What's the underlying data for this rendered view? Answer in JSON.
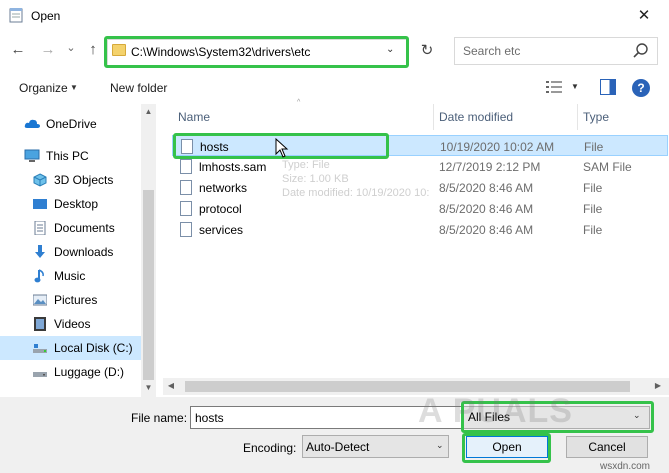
{
  "window": {
    "title": "Open",
    "close_glyph": "✕"
  },
  "nav": {
    "back_glyph": "←",
    "forward_glyph": "→",
    "recent_glyph": "⌄",
    "up_glyph": "↑",
    "address": "C:\\Windows\\System32\\drivers\\etc",
    "address_dropdown": "⌄",
    "refresh_glyph": "↻",
    "search_placeholder": "Search etc"
  },
  "toolbar": {
    "organize": "Organize",
    "organize_caret": "▼",
    "new_folder": "New folder",
    "view_caret": "▼",
    "help": "?"
  },
  "sidebar": {
    "items": [
      {
        "label": "OneDrive",
        "icon": "cloud-icon"
      },
      {
        "label": "This PC",
        "icon": "computer-icon"
      },
      {
        "label": "3D Objects",
        "icon": "cube-icon"
      },
      {
        "label": "Desktop",
        "icon": "desktop-icon"
      },
      {
        "label": "Documents",
        "icon": "documents-icon"
      },
      {
        "label": "Downloads",
        "icon": "download-icon"
      },
      {
        "label": "Music",
        "icon": "music-icon"
      },
      {
        "label": "Pictures",
        "icon": "pictures-icon"
      },
      {
        "label": "Videos",
        "icon": "videos-icon"
      },
      {
        "label": "Local Disk (C:)",
        "icon": "drive-icon"
      },
      {
        "label": "Luggage (D:)",
        "icon": "drive-icon"
      }
    ],
    "selected_index": 9
  },
  "columns": {
    "name": "Name",
    "date": "Date modified",
    "type": "Type",
    "sort_caret": "^"
  },
  "files": [
    {
      "name": "hosts",
      "date": "10/19/2020 10:02 AM",
      "type": "File"
    },
    {
      "name": "lmhosts.sam",
      "date": "12/7/2019 2:12 PM",
      "type": "SAM File"
    },
    {
      "name": "networks",
      "date": "8/5/2020 8:46 AM",
      "type": "File"
    },
    {
      "name": "protocol",
      "date": "8/5/2020 8:46 AM",
      "type": "File"
    },
    {
      "name": "services",
      "date": "8/5/2020 8:46 AM",
      "type": "File"
    }
  ],
  "tooltip": {
    "line1": "Type: File",
    "line2": "Size: 1.00 KB",
    "line3": "Date modified: 10/19/2020 10:"
  },
  "footer": {
    "file_name_label": "File name:",
    "file_name_value": "hosts",
    "filter_value": "All Files",
    "encoding_label": "Encoding:",
    "encoding_value": "Auto-Detect",
    "open_label": "Open",
    "cancel_label": "Cancel",
    "caret": "⌄"
  },
  "watermark": "A PUALS",
  "site": "wsxdn.com",
  "colors": {
    "highlight": "#35c24a",
    "selection": "#cce8ff",
    "accent": "#0078d7"
  }
}
